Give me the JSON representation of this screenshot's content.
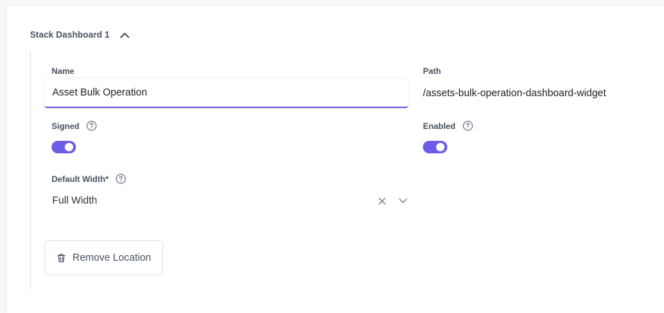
{
  "section": {
    "title": "Stack Dashboard 1",
    "icon": "chevron-up-icon"
  },
  "fields": {
    "name": {
      "label": "Name",
      "value": "Asset Bulk Operation"
    },
    "path": {
      "label": "Path",
      "value": "/assets-bulk-operation-dashboard-widget"
    },
    "signed": {
      "label": "Signed",
      "enabled": true
    },
    "enabled": {
      "label": "Enabled",
      "enabled": true
    },
    "default_width": {
      "label": "Default Width*",
      "value": "Full Width"
    }
  },
  "actions": {
    "remove_label": "Remove Location"
  },
  "colors": {
    "accent": "#6c5ce7",
    "label": "#475161",
    "border": "#dde1e6"
  }
}
